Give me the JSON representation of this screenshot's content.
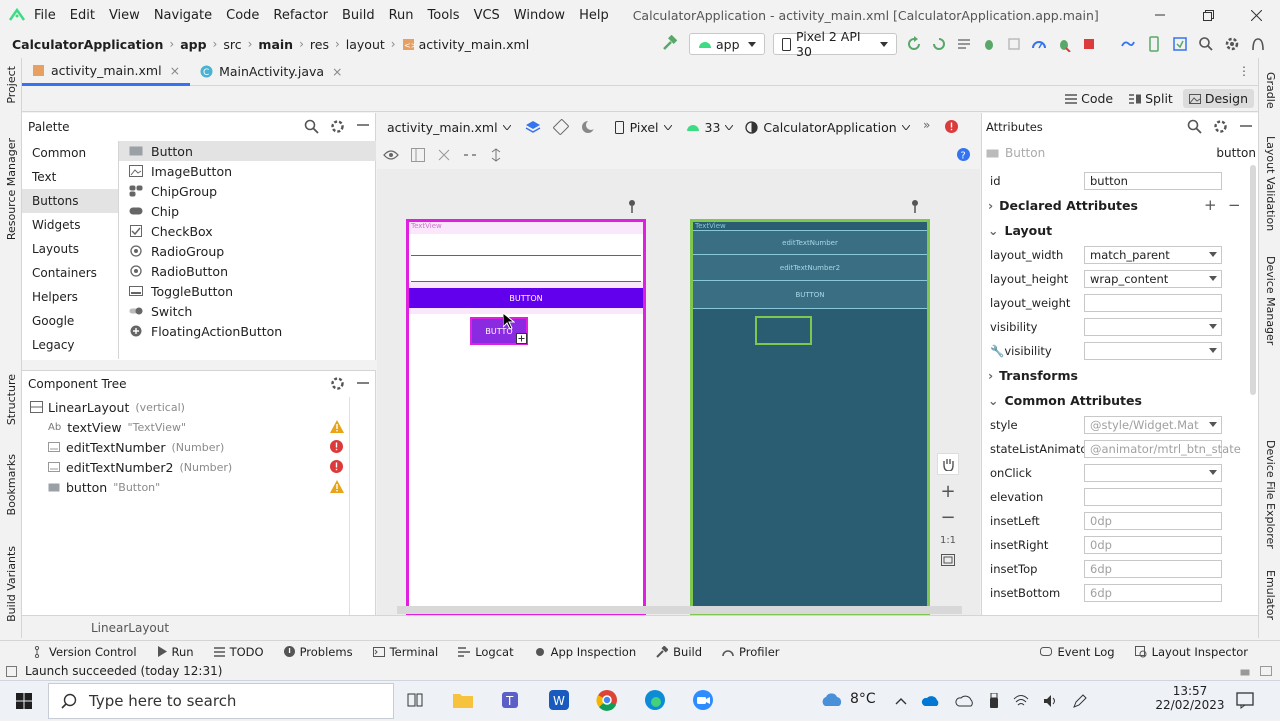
{
  "menu": {
    "items": [
      "File",
      "Edit",
      "View",
      "Navigate",
      "Code",
      "Refactor",
      "Build",
      "Run",
      "Tools",
      "VCS",
      "Window",
      "Help"
    ],
    "title": "CalculatorApplication - activity_main.xml [CalculatorApplication.app.main]"
  },
  "breadcrumb": [
    "CalculatorApplication",
    "app",
    "src",
    "main",
    "res",
    "layout",
    "activity_main.xml"
  ],
  "toolbar": {
    "run_config": "app",
    "device": "Pixel 2 API 30"
  },
  "tabs": [
    "activity_main.xml",
    "MainActivity.java"
  ],
  "view_modes": [
    "Code",
    "Split",
    "Design"
  ],
  "left_strip": [
    "Project",
    "Resource Manager",
    "Structure",
    "Bookmarks",
    "Build Variants"
  ],
  "right_strip": [
    "Gradle",
    "Layout Validation",
    "Device Manager",
    "Device File Explorer",
    "Emulator"
  ],
  "palette": {
    "title": "Palette",
    "categories": [
      "Common",
      "Text",
      "Buttons",
      "Widgets",
      "Layouts",
      "Containers",
      "Helpers",
      "Google",
      "Legacy"
    ],
    "selected": "Buttons",
    "items": [
      "Button",
      "ImageButton",
      "ChipGroup",
      "Chip",
      "CheckBox",
      "RadioGroup",
      "RadioButton",
      "ToggleButton",
      "Switch",
      "FloatingActionButton"
    ]
  },
  "component_tree": {
    "title": "Component Tree",
    "root": "LinearLayout",
    "root_hint": "(vertical)",
    "children": [
      {
        "icon": "Ab",
        "name": "textView",
        "hint": "\"TextView\"",
        "status": "warning"
      },
      {
        "icon": "",
        "name": "editTextNumber",
        "hint": "(Number)",
        "status": "error"
      },
      {
        "icon": "",
        "name": "editTextNumber2",
        "hint": "(Number)",
        "status": "error"
      },
      {
        "icon": "",
        "name": "button",
        "hint": "\"Button\"",
        "status": "warning"
      }
    ]
  },
  "design_toolbar": {
    "file": "activity_main.xml",
    "device": "Pixel",
    "api": "33",
    "theme": "CalculatorApplication"
  },
  "design": {
    "textview_label": "TextView",
    "button_label": "BUTTON",
    "dragged_label": "BUTTO",
    "blueprint_edit1": "editTextNumber",
    "blueprint_edit2": "editTextNumber2",
    "blueprint_button": "BUTTON",
    "blueprint_textview": "TextView",
    "zoom_ratio": "1:1"
  },
  "attributes": {
    "title": "Attributes",
    "widget_type": "Button",
    "widget_id_label": "button",
    "id_label": "id",
    "id_value": "button",
    "declared": "Declared Attributes",
    "layout": "Layout",
    "layout_width_label": "layout_width",
    "layout_width": "match_parent",
    "layout_height_label": "layout_height",
    "layout_height": "wrap_content",
    "layout_weight_label": "layout_weight",
    "visibility_label": "visibility",
    "transforms": "Transforms",
    "common": "Common Attributes",
    "style_label": "style",
    "style": "@style/Widget.Mat",
    "sla_label": "stateListAnimator",
    "sla": "@animator/mtrl_btn_state",
    "onclick_label": "onClick",
    "elevation_label": "elevation",
    "insetLeft_label": "insetLeft",
    "insetLeft": "0dp",
    "insetRight_label": "insetRight",
    "insetRight": "0dp",
    "insetTop_label": "insetTop",
    "insetTop": "6dp",
    "insetBottom_label": "insetBottom",
    "insetBottom": "6dp"
  },
  "footer_crumb": "LinearLayout",
  "bottom_tabs": [
    "Version Control",
    "Run",
    "TODO",
    "Problems",
    "Terminal",
    "Logcat",
    "App Inspection",
    "Build",
    "Profiler"
  ],
  "bottom_right_tabs": [
    "Event Log",
    "Layout Inspector"
  ],
  "status_text": "Launch succeeded (today 12:31)",
  "taskbar": {
    "search_placeholder": "Type here to search",
    "weather": "8°C",
    "time": "13:57",
    "date": "22/02/2023"
  },
  "colors": {
    "accent": "#3574f0",
    "button_purple": "#6200ee",
    "selection_magenta": "#e020e0",
    "blueprint": "#2a5d72",
    "blueprint_green": "#7ec850",
    "error": "#db3b3b",
    "warning": "#e8a317"
  }
}
